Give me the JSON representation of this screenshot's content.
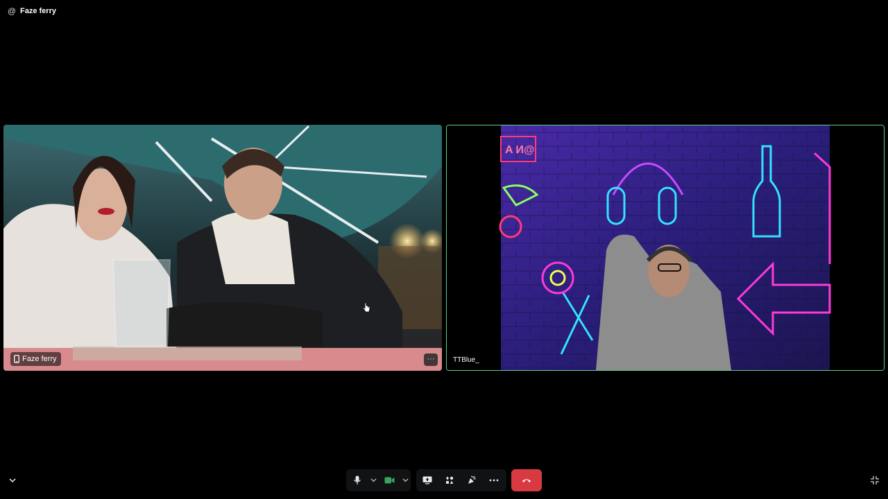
{
  "header": {
    "channel_icon": "at-icon",
    "title": "Faze ferry"
  },
  "tiles": [
    {
      "name": "Faze ferry",
      "device_icon": "mobile-icon",
      "more_icon": "ellipsis-icon",
      "more_label": "···"
    },
    {
      "name": "TTBlue_",
      "speaking": true,
      "accent": "#5ad18f"
    }
  ],
  "controls": {
    "mic_icon": "microphone-icon",
    "camera_icon": "camera-icon",
    "screen_share_icon": "screen-share-icon",
    "activities_icon": "activities-icon",
    "soundboard_icon": "soundboard-icon",
    "more_icon": "ellipsis-icon",
    "more_label": "···",
    "leave_icon": "hang-up-icon",
    "leave_color": "#d83a42",
    "camera_on_color": "#3ba55d"
  },
  "corner": {
    "left": "chevron-down-icon",
    "right": "exit-fullscreen-icon"
  }
}
